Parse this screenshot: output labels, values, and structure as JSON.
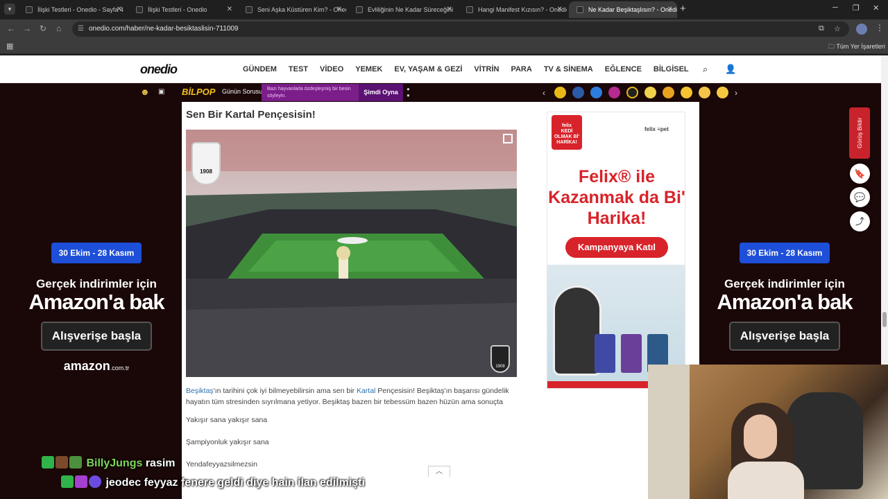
{
  "browser": {
    "tabs": [
      {
        "title": "İlişki Testleri - Onedio - Sayfa 4",
        "active": false
      },
      {
        "title": "İlişki Testleri - Onedio",
        "active": false
      },
      {
        "title": "Seni Aşka Küstüren Kim? - Onedio",
        "active": false
      },
      {
        "title": "Evliliğinin Ne Kadar Süreceğini",
        "active": false
      },
      {
        "title": "Hangi Manifest Kızısın? - Onedio",
        "active": false
      },
      {
        "title": "Ne Kadar Beşiktaşlısın? - Onedio",
        "active": true
      }
    ],
    "url": "onedio.com/haber/ne-kadar-besiktaslisin-711009",
    "bookmarks_folder": "Tüm Yer İşaretleri"
  },
  "site": {
    "logo": "onedio",
    "menu": [
      "GÜNDEM",
      "TEST",
      "VİDEO",
      "YEMEK",
      "EV, YAŞAM & GEZİ",
      "VİTRİN",
      "PARA",
      "TV & SİNEMA",
      "EĞLENCE",
      "BİLGİSEL"
    ]
  },
  "bilpop": {
    "logo": "BİLPOP",
    "question_label": "Günün Sorusu",
    "question_text": "Bazı hayvanlarla özdeşleşmiş bir besin söyleyin.",
    "play_label": "Şimdi Oyna"
  },
  "article": {
    "title": "Sen Bir Kartal Pençesisin!",
    "crest_year": "1908",
    "para1_link1": "Beşiktaş",
    "para1_a": "'ın tarihini çok iyi bilmeyebilirsin ama sen bir ",
    "para1_link2": "Kartal",
    "para1_b": " Pençesisin! Beşiktaş'ın başarısı gündelik hayatın tüm stresinden sıyrılmana yetiyor. Beşiktaş bazen bir tebessüm bazen hüzün ama sonuçta",
    "line2": "Yakışır sana yakışır sana",
    "line3": "Şampiyonluk yakışır sana",
    "line4": "Yendafeyyazsilmezsin"
  },
  "felix_ad": {
    "brand": "felix",
    "badge_text": "KEDİ OLMAK Bİ' HARİKA!",
    "partner": "felix  ≡pet",
    "headline": "Felix® ile Kazanmak da Bi' Harika!",
    "button": "Kampanyaya Katıl"
  },
  "amazon_ad": {
    "dates": "30 Ekim - 28 Kasım",
    "line1": "Gerçek indirimler için",
    "line2": "Amazon'a bak",
    "button": "Alışverişe başla",
    "logo": "amazon",
    "logo_suffix": ".com.tr"
  },
  "feedback": {
    "label": "Görüş Bildir"
  },
  "stream_chat": [
    {
      "user": "BillyJungs",
      "user_color": "#7fd65a",
      "message": "rasim"
    },
    {
      "user": "jeodec",
      "user_color": "#ffffff",
      "message": "feyyaz fenere geldi diye hain ilan edilmişti"
    }
  ],
  "colors": {
    "onedio_red": "#c8232c",
    "felix_red": "#d8232a",
    "amazon_blue": "#1d4fd8",
    "bilpop_purple": "#7b1e8a",
    "link_blue": "#2c6fb0"
  }
}
